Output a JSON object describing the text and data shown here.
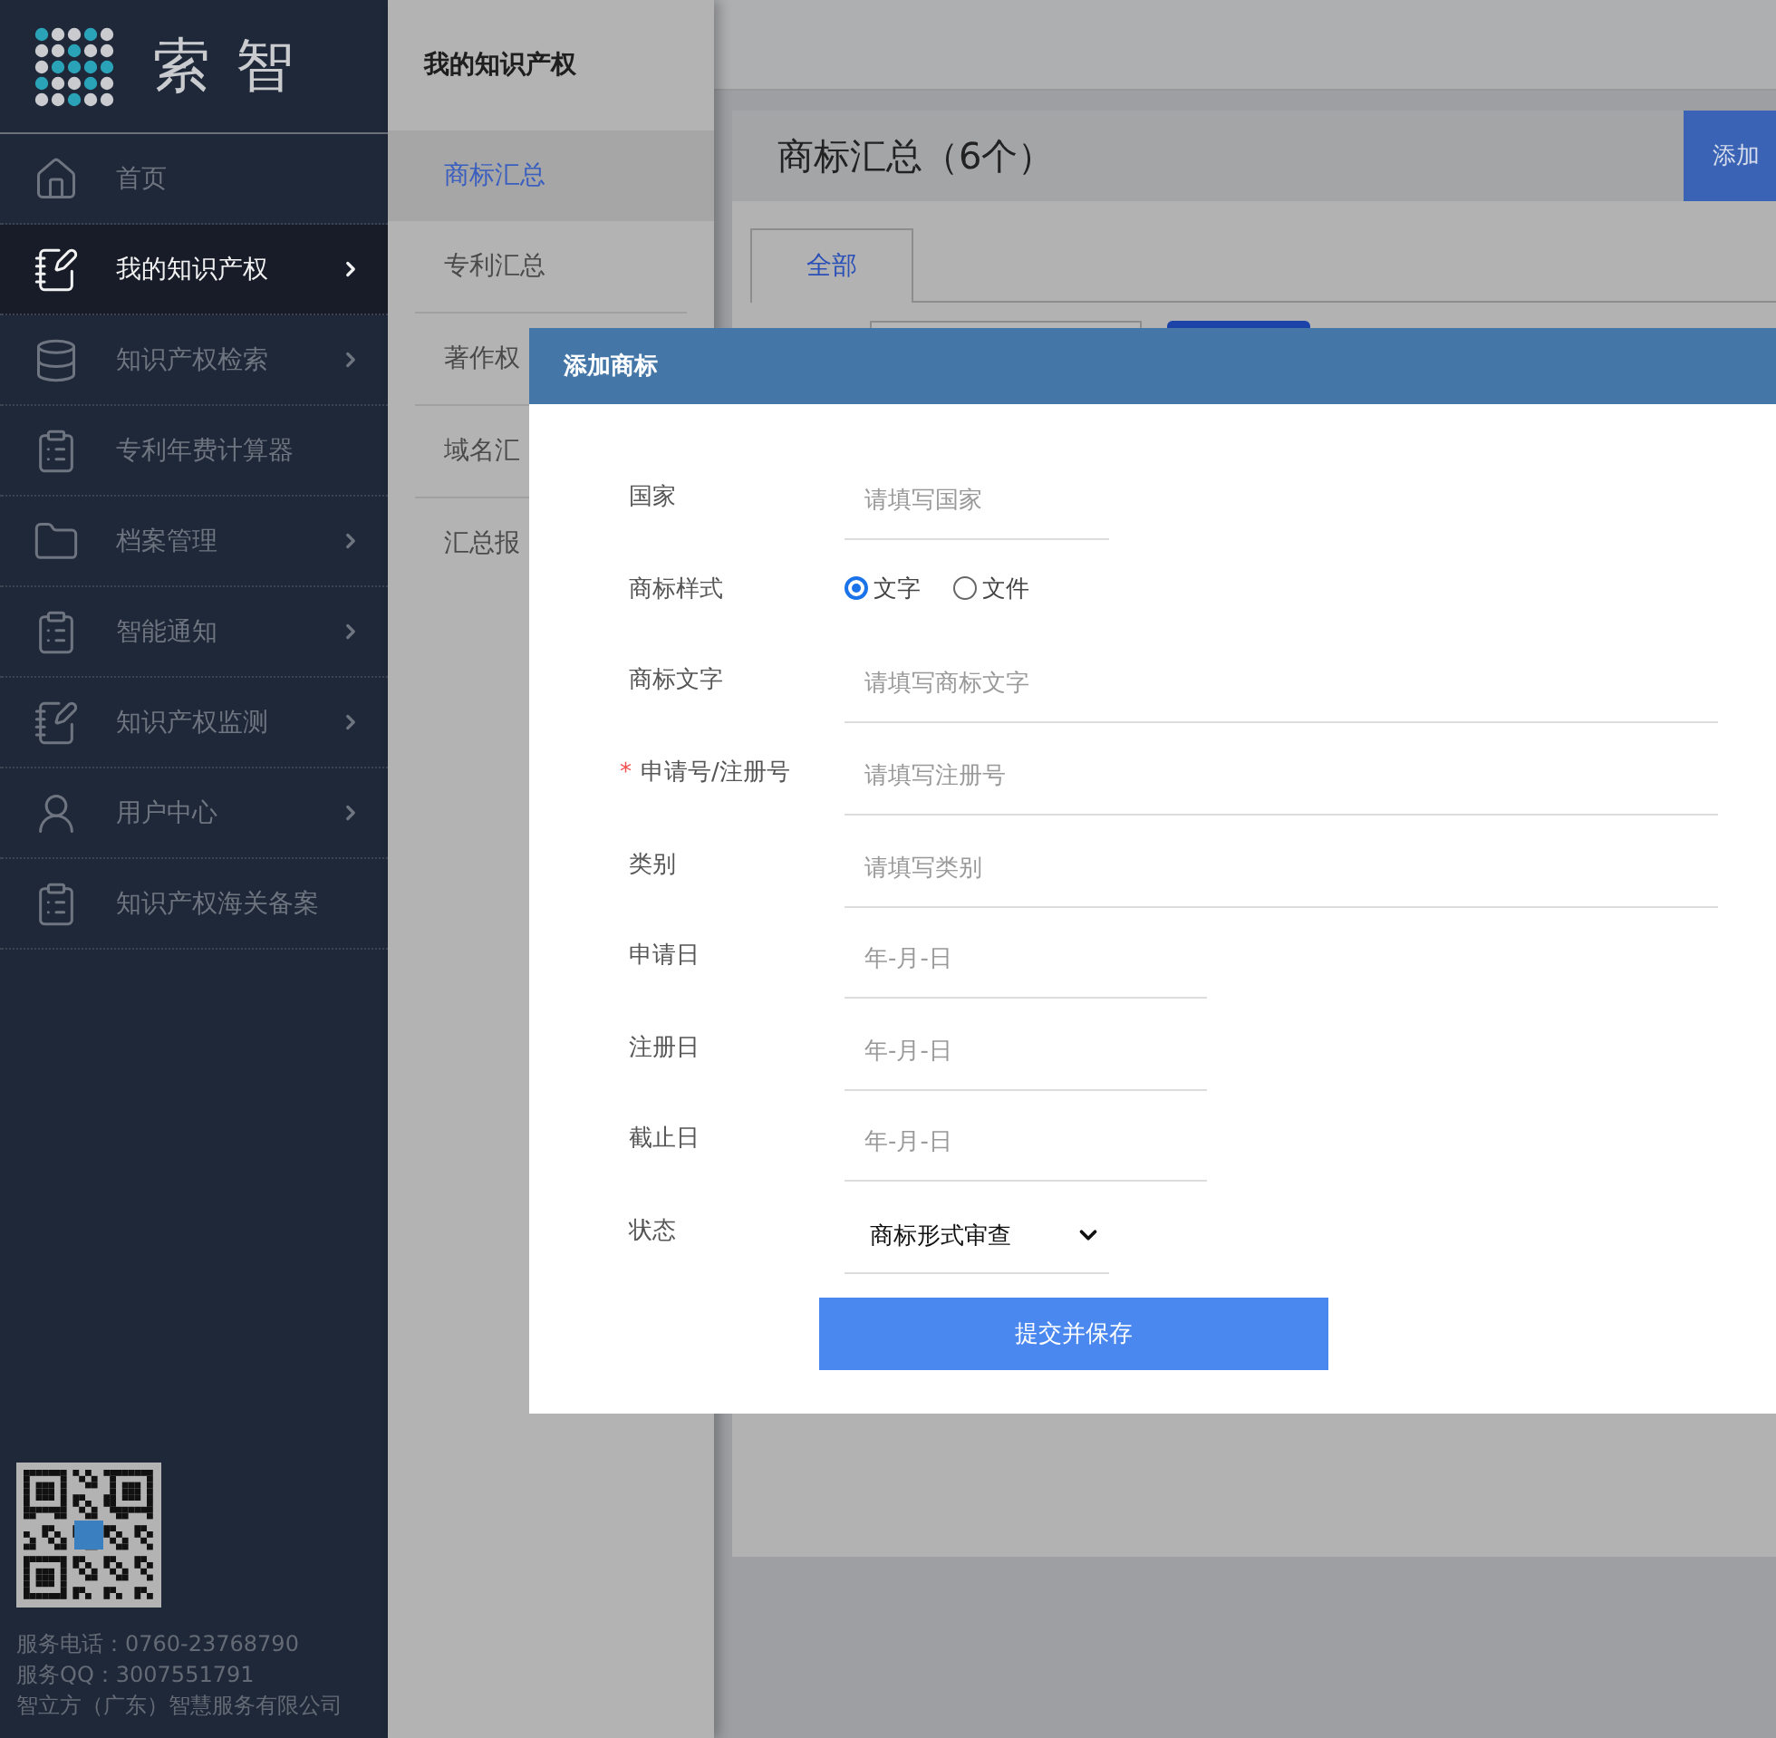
{
  "sidebar": {
    "logo_text": "索智",
    "items": [
      {
        "label": "首页",
        "selected": false,
        "expandable": false
      },
      {
        "label": "我的知识产权",
        "selected": true,
        "expandable": true
      },
      {
        "label": "知识产权检索",
        "selected": false,
        "expandable": true
      },
      {
        "label": "专利年费计算器",
        "selected": false,
        "expandable": false
      },
      {
        "label": "档案管理",
        "selected": false,
        "expandable": true
      },
      {
        "label": "智能通知",
        "selected": false,
        "expandable": true
      },
      {
        "label": "知识产权监测",
        "selected": false,
        "expandable": true
      },
      {
        "label": "用户中心",
        "selected": false,
        "expandable": true
      },
      {
        "label": "知识产权海关备案",
        "selected": false,
        "expandable": false
      }
    ],
    "footer": [
      "服务电话：0760-23768790",
      "服务QQ：3007551791",
      "智立方（广东）智慧服务有限公司"
    ]
  },
  "subnav": {
    "title": "我的知识产权",
    "items": [
      {
        "label": "商标汇总",
        "selected": true
      },
      {
        "label": "专利汇总",
        "selected": false
      },
      {
        "label": "著作权",
        "selected": false
      },
      {
        "label": "域名汇",
        "selected": false
      },
      {
        "label": "汇总报",
        "selected": false
      }
    ]
  },
  "main": {
    "title": "商标汇总（6个）",
    "add_button": "添加",
    "tabs": [
      {
        "label": "全部",
        "selected": true
      }
    ]
  },
  "modal": {
    "title": "添加商标",
    "fields": [
      {
        "kind": "short_text",
        "label": "国家",
        "placeholder": "请填写国家"
      },
      {
        "kind": "radio",
        "label": "商标样式",
        "options": [
          {
            "label": "文字",
            "selected": true
          },
          {
            "label": "文件",
            "selected": false
          }
        ]
      },
      {
        "kind": "text",
        "label": "商标文字",
        "placeholder": "请填写商标文字"
      },
      {
        "kind": "text",
        "label": "申请号/注册号",
        "required_mark": "*",
        "placeholder": "请填写注册号"
      },
      {
        "kind": "text",
        "label": "类别",
        "placeholder": "请填写类别"
      },
      {
        "kind": "date",
        "label": "申请日",
        "placeholder": "年-月-日"
      },
      {
        "kind": "date",
        "label": "注册日",
        "placeholder": "年-月-日"
      },
      {
        "kind": "date",
        "label": "截止日",
        "placeholder": "年-月-日"
      },
      {
        "kind": "select",
        "label": "状态",
        "value": "商标形式审查"
      }
    ],
    "submit": "提交并保存"
  }
}
